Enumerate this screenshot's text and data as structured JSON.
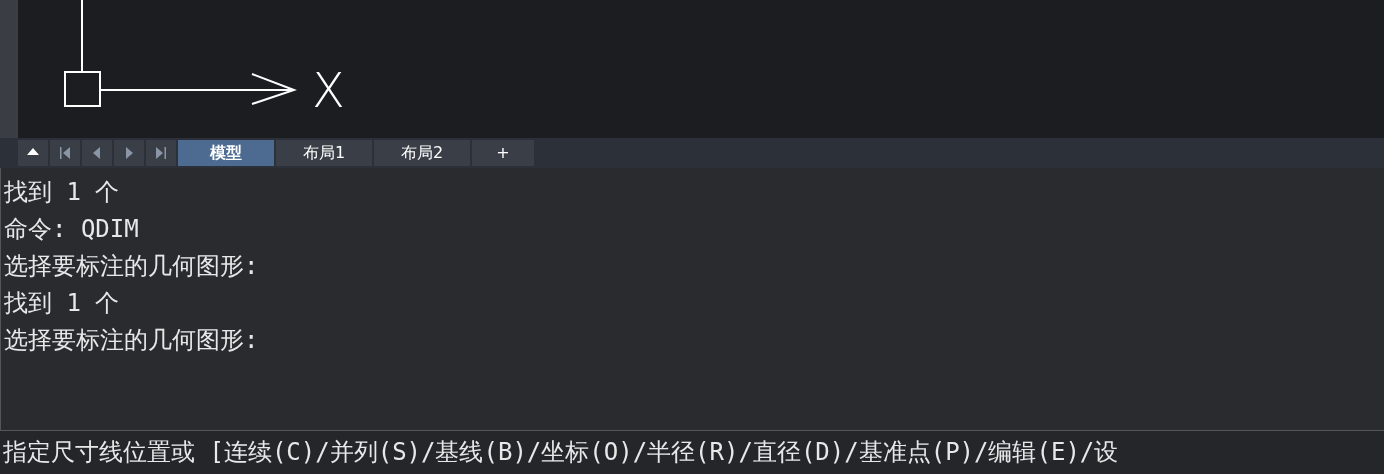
{
  "canvas": {
    "axis_label": "X"
  },
  "layout_tabs": [
    {
      "label": "模型",
      "selected": true
    },
    {
      "label": "布局1",
      "selected": false
    },
    {
      "label": "布局2",
      "selected": false
    },
    {
      "label": "+",
      "selected": false
    }
  ],
  "command_history": [
    "找到 1 个",
    "命令: QDIM",
    "选择要标注的几何图形:",
    "找到 1 个",
    "选择要标注的几何图形:"
  ],
  "command_prompt": "指定尺寸线位置或 [连续(C)/并列(S)/基线(B)/坐标(O)/半径(R)/直径(D)/基准点(P)/编辑(E)/设"
}
